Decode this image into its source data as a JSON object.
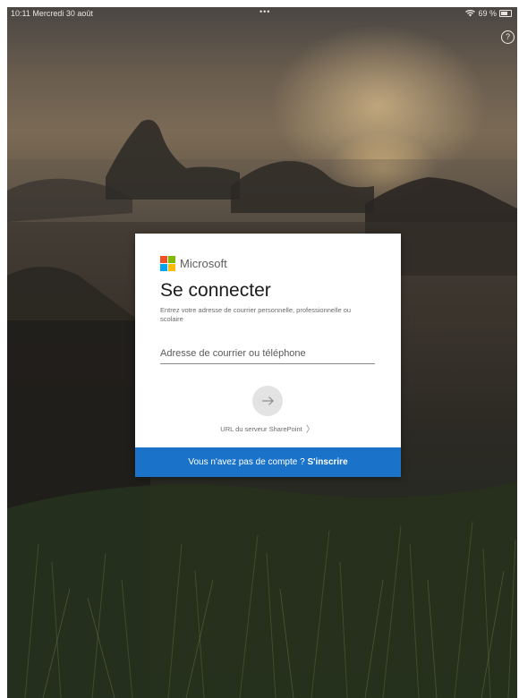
{
  "status_bar": {
    "time_date": "10:11  Mercredi 30 août",
    "dots": "•••",
    "battery": "69 %",
    "battery_level": 0.69
  },
  "help": {
    "icon": "question-circle-icon",
    "glyph": "?"
  },
  "login_card": {
    "brand": "Microsoft",
    "title": "Se connecter",
    "subtitle": "Entrez votre adresse de courrier personnelle, professionnelle ou scolaire",
    "email_placeholder": "Adresse de courrier ou téléphone",
    "email_value": "",
    "next_icon": "arrow-right-icon",
    "sharepoint_label": "URL du serveur SharePoint",
    "no_account_text": "Vous n'avez pas de compte ?",
    "signup_label": "S'inscrire"
  },
  "colors": {
    "accent": "#1a73c8",
    "logo_red": "#f25022",
    "logo_green": "#7fba00",
    "logo_blue": "#00a4ef",
    "logo_yellow": "#ffb900"
  }
}
